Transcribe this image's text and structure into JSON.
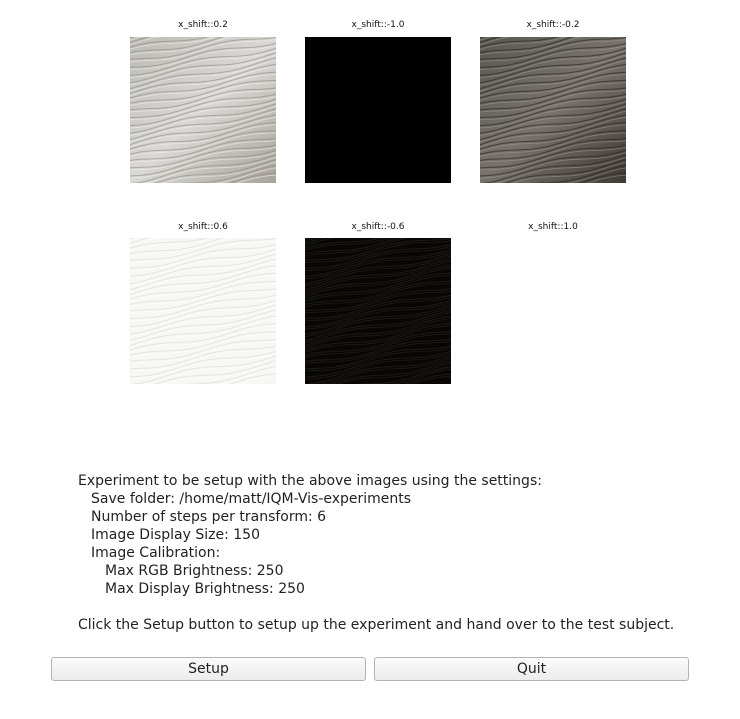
{
  "images": [
    {
      "caption": "x_shift::0.2",
      "tone": "light"
    },
    {
      "caption": "x_shift::-1.0",
      "tone": "black"
    },
    {
      "caption": "x_shift::-0.2",
      "tone": "dark"
    },
    {
      "caption": "x_shift::0.6",
      "tone": "white"
    },
    {
      "caption": "x_shift::-0.6",
      "tone": "verydark"
    },
    {
      "caption": "x_shift::1.0",
      "tone": "none"
    }
  ],
  "info": {
    "heading": "Experiment to be setup with the above images using the settings:",
    "save_folder": "Save folder: /home/matt/IQM-Vis-experiments",
    "steps": "Number of steps per transform: 6",
    "display_size": "Image Display Size: 150",
    "calibration": "Image Calibration:",
    "max_rgb": "Max RGB Brightness: 250",
    "max_display": "Max Display Brightness: 250",
    "instructions": "Click the Setup button to setup up the experiment and hand over to the test subject."
  },
  "buttons": {
    "setup": "Setup",
    "quit": "Quit"
  }
}
